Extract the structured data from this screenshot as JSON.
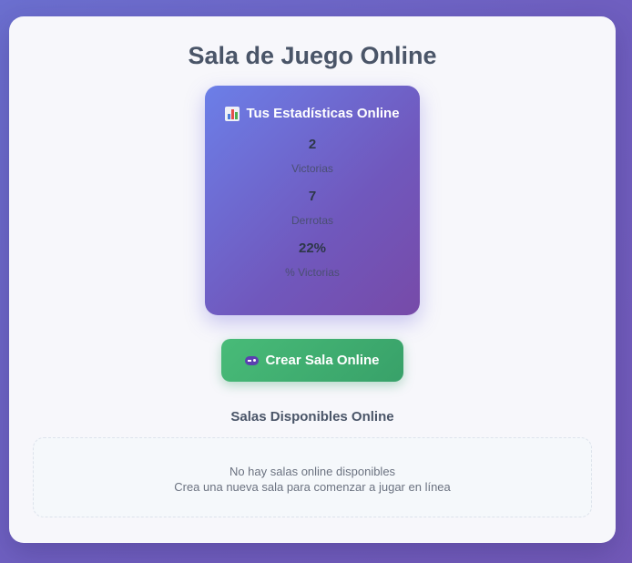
{
  "page": {
    "title": "Sala de Juego Online"
  },
  "stats": {
    "heading": "Tus Estadísticas Online",
    "heading_icon": "bar-chart-icon",
    "items": [
      {
        "value": "2",
        "label": "Victorias"
      },
      {
        "value": "7",
        "label": "Derrotas"
      },
      {
        "value": "22%",
        "label": "% Victorias"
      }
    ]
  },
  "actions": {
    "create_room_label": "Crear Sala Online",
    "create_room_icon": "gamepad-icon"
  },
  "rooms": {
    "heading": "Salas Disponibles Online",
    "empty_title": "No hay salas online disponibles",
    "empty_hint": "Crea una nueva sala para comenzar a jugar en línea"
  },
  "colors": {
    "background": "#6f5fc0",
    "card_gradient_start": "#6c7fe8",
    "card_gradient_end": "#774aa8",
    "button_green": "#48bb78",
    "heading_text": "#4a5568"
  }
}
